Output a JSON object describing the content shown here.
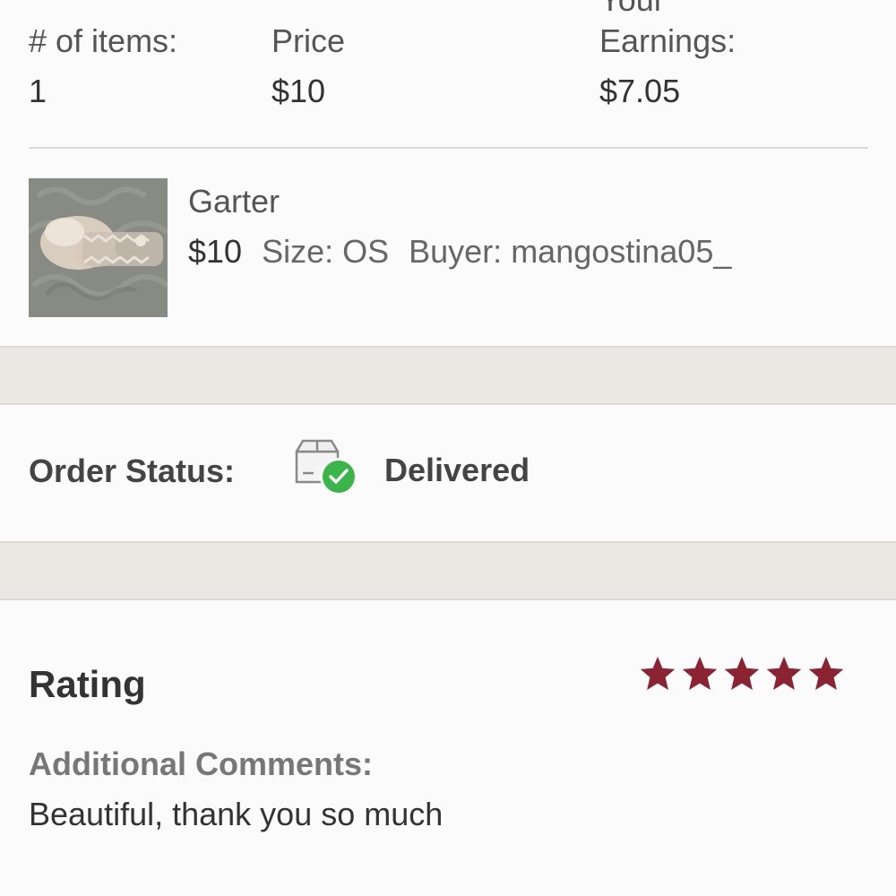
{
  "summary": {
    "items_label": "# of items:",
    "items_value": "1",
    "price_label": "Price",
    "price_value": "$10",
    "earnings_label_top": "Your",
    "earnings_label": "Earnings:",
    "earnings_value": "$7.05"
  },
  "product": {
    "name": "Garter",
    "price": "$10",
    "size": "Size: OS",
    "buyer": "Buyer: mangostina05_",
    "thumbnail_icon": "product-photo"
  },
  "order_status": {
    "label": "Order Status:",
    "value": "Delivered",
    "icon": "package-delivered-icon",
    "check_color": "#3bb54a"
  },
  "rating": {
    "label": "Rating",
    "stars": 5,
    "max_stars": 5,
    "star_color": "#8b2332"
  },
  "comments": {
    "label": "Additional Comments:",
    "text": "Beautiful, thank you so much"
  }
}
